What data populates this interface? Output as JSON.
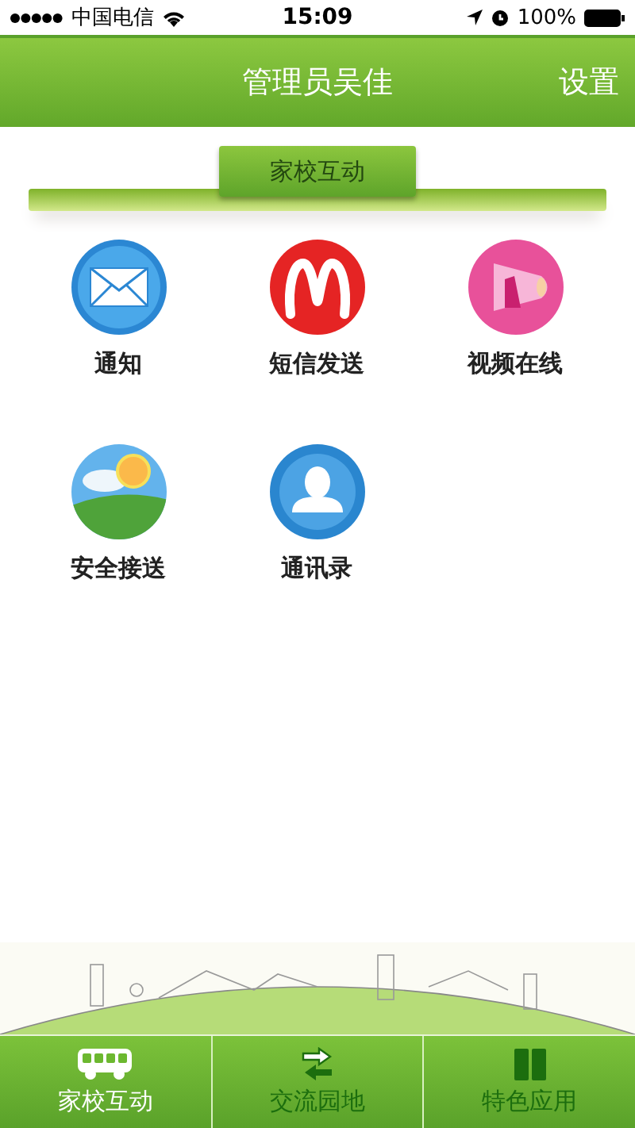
{
  "status_bar": {
    "carrier": "中国电信",
    "time": "15:09",
    "battery": "100%"
  },
  "header": {
    "title": "管理员吴佳",
    "action": "设置"
  },
  "section": {
    "title": "家校互动"
  },
  "apps": [
    {
      "label": "通知",
      "kind": "mail"
    },
    {
      "label": "短信发送",
      "kind": "sms"
    },
    {
      "label": "视频在线",
      "kind": "video"
    },
    {
      "label": "安全接送",
      "kind": "weather"
    },
    {
      "label": "通讯录",
      "kind": "contacts"
    }
  ],
  "tabs": [
    {
      "label": "家校互动",
      "kind": "bus",
      "selected": true
    },
    {
      "label": "交流园地",
      "kind": "exchange",
      "selected": false
    },
    {
      "label": "特色应用",
      "kind": "apps",
      "selected": false
    }
  ]
}
